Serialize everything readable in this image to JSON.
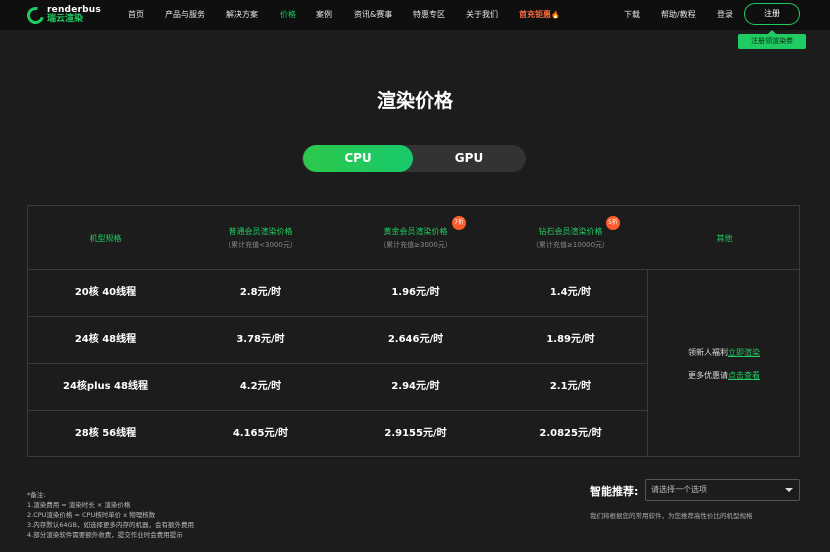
{
  "nav": {
    "logo_en": "renderbus",
    "logo_cn": "瑞云渲染",
    "items": [
      "首页",
      "产品与服务",
      "解决方案",
      "价格",
      "案例",
      "资讯&赛事",
      "特惠专区",
      "关于我们"
    ],
    "promo": "首充钜惠",
    "right_items": [
      "下载",
      "帮助/教程",
      "登录"
    ],
    "register": "注册",
    "register_tip": "注册领渲染券"
  },
  "page_title": "渲染价格",
  "toggle": {
    "cpu": "CPU",
    "gpu": "GPU",
    "selected": "CPU"
  },
  "table": {
    "headers": [
      {
        "label": "机型规格",
        "sub": ""
      },
      {
        "label": "普通会员渲染价格",
        "sub": "（累计充值<3000元）"
      },
      {
        "label": "黄金会员渲染价格",
        "sub": "（累计充值≥3000元）",
        "badge": "7折"
      },
      {
        "label": "钻石会员渲染价格",
        "sub": "（累计充值≥10000元）",
        "badge": "5折"
      },
      {
        "label": "其他",
        "sub": ""
      }
    ],
    "rows": [
      {
        "spec": "20核 40线程",
        "normal": "2.8元/时",
        "gold": "1.96元/时",
        "diamond": "1.4元/时"
      },
      {
        "spec": "24核 48线程",
        "normal": "3.78元/时",
        "gold": "2.646元/时",
        "diamond": "1.89元/时"
      },
      {
        "spec": "24核plus 48线程",
        "normal": "4.2元/时",
        "gold": "2.94元/时",
        "diamond": "2.1元/时"
      },
      {
        "spec": "28核 56线程",
        "normal": "4.165元/时",
        "gold": "2.9155元/时",
        "diamond": "2.0825元/时"
      }
    ],
    "other": {
      "line1_text": "领新人福利",
      "line1_link": "立即渲染",
      "line2_text": "更多优惠请",
      "line2_link": "点击查看"
    }
  },
  "notes": [
    "*备注:",
    "1.渲染费用 = 渲染时长 × 渲染价格",
    "2.CPU渲染价格 = CPU核时单价 x 物理核数",
    "3.内存默认64GB，如选择更多内存的机器，会有额外费用",
    "4.部分渲染软件需要额外收费，提交作业时会费用提示"
  ],
  "recommend": {
    "label": "智能推荐:",
    "placeholder": "请选择一个选项",
    "hint": "我们将根据您的常用软件，为您推荐高性价比的机型规格"
  },
  "colors": {
    "accent": "#1fcc61",
    "promo": "#ff6a3d",
    "badge": "#ff5a2a",
    "background": "#1c1c1c"
  }
}
